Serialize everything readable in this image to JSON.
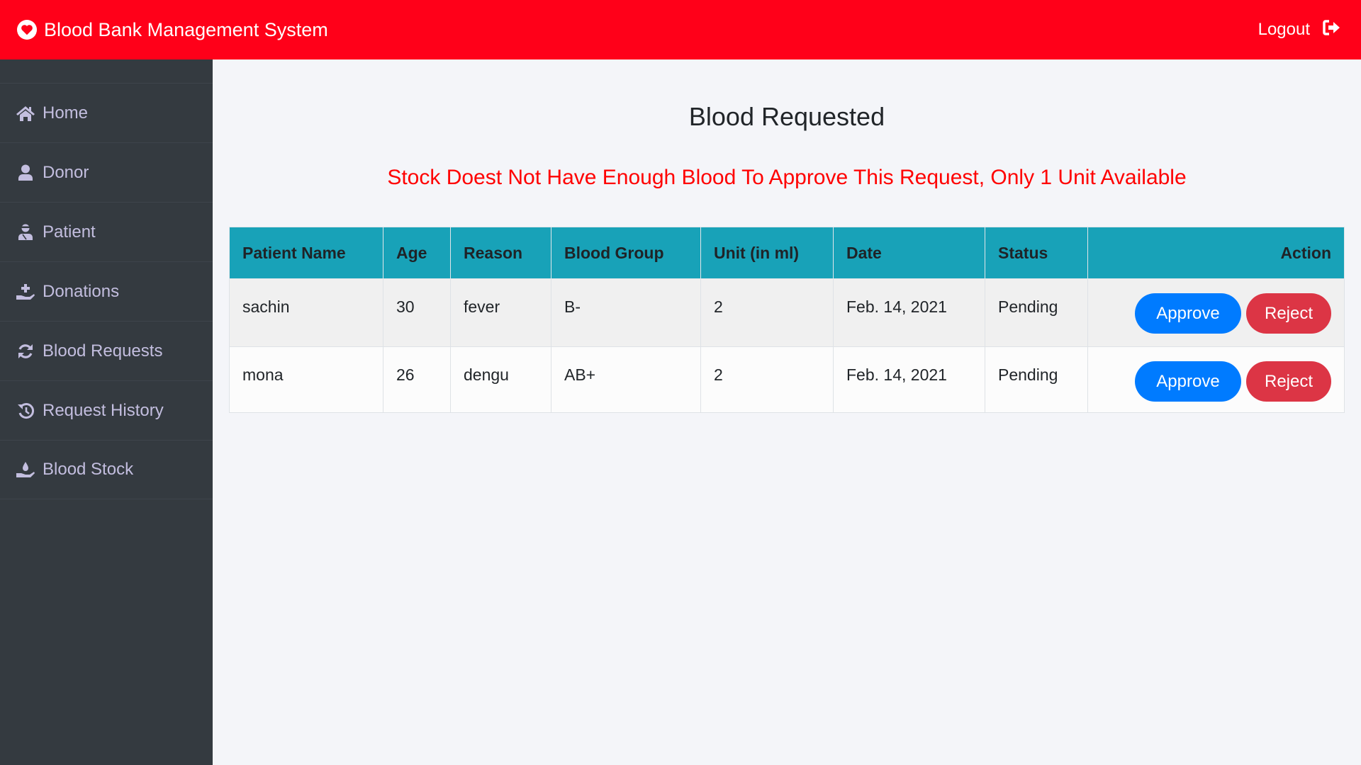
{
  "header": {
    "app_title": "Blood Bank Management System",
    "logo_icon": "heart-circle-icon",
    "logout_label": "Logout",
    "logout_icon": "sign-out-icon",
    "background_color": "#ff0019"
  },
  "sidebar": {
    "items": [
      {
        "label": "Home",
        "icon": "home-icon"
      },
      {
        "label": "Donor",
        "icon": "user-icon"
      },
      {
        "label": "Patient",
        "icon": "user-injured-icon"
      },
      {
        "label": "Donations",
        "icon": "hand-holding-medical-icon"
      },
      {
        "label": "Blood Requests",
        "icon": "sync-icon"
      },
      {
        "label": "Request History",
        "icon": "history-icon"
      },
      {
        "label": "Blood Stock",
        "icon": "hand-holding-water-icon"
      }
    ]
  },
  "main": {
    "title": "Blood Requested",
    "alert_message": "Stock Doest Not Have Enough Blood To Approve This Request, Only 1 Unit Available",
    "table": {
      "columns": [
        "Patient Name",
        "Age",
        "Reason",
        "Blood Group",
        "Unit (in ml)",
        "Date",
        "Status",
        "Action"
      ],
      "rows": [
        {
          "patient_name": "sachin",
          "age": "30",
          "reason": "fever",
          "blood_group": "B-",
          "unit": "2",
          "date": "Feb. 14, 2021",
          "status": "Pending",
          "approve_label": "Approve",
          "reject_label": "Reject"
        },
        {
          "patient_name": "mona",
          "age": "26",
          "reason": "dengu",
          "blood_group": "AB+",
          "unit": "2",
          "date": "Feb. 14, 2021",
          "status": "Pending",
          "approve_label": "Approve",
          "reject_label": "Reject"
        }
      ]
    }
  },
  "colors": {
    "header_bg": "#ff0019",
    "sidebar_bg": "#343a40",
    "table_header_bg": "#18a2b8",
    "approve": "#007bff",
    "reject": "#dc3545",
    "alert_text": "#ff0000"
  }
}
